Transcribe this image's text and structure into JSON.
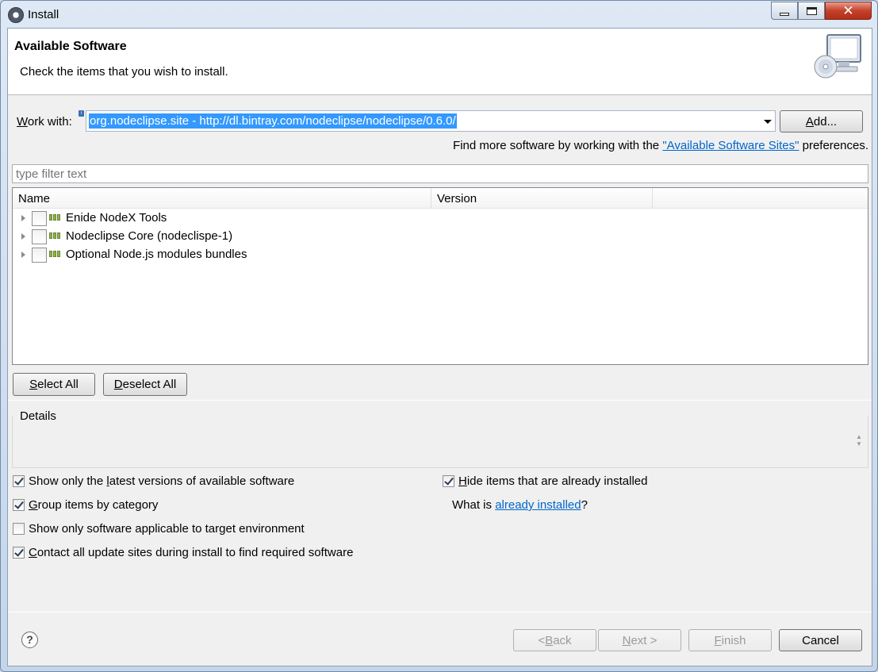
{
  "window": {
    "title": "Install"
  },
  "header": {
    "title": "Available Software",
    "description": "Check the items that you wish to install."
  },
  "work_with": {
    "label_underline": "W",
    "label_rest": "ork with:",
    "value": "org.nodeclipse.site - http://dl.bintray.com/nodeclipse/nodeclipse/0.6.0/",
    "add_label_underline": "A",
    "add_label_rest": "dd..."
  },
  "find_more": {
    "prefix": "Find more software by working with the ",
    "link": "\"Available Software Sites\"",
    "suffix": " preferences."
  },
  "filter": {
    "placeholder": "type filter text"
  },
  "tree": {
    "columns": [
      "Name",
      "Version"
    ],
    "items": [
      {
        "label": "Enide NodeX Tools"
      },
      {
        "label": "Nodeclipse Core (nodeclispe-1)"
      },
      {
        "label": "Optional Node.js modules bundles"
      }
    ]
  },
  "selection_buttons": {
    "select_all_u": "S",
    "select_all_rest": "elect All",
    "deselect_all_u": "D",
    "deselect_all_rest": "eselect All"
  },
  "details": {
    "label": "Details"
  },
  "options": {
    "latest": {
      "pre": "Show only the ",
      "u": "l",
      "post": "atest versions of available software"
    },
    "group": {
      "pre": "",
      "u": "G",
      "post": "roup items by category"
    },
    "applicable": {
      "pre": "Show only software applicable to target environment",
      "u": "",
      "post": ""
    },
    "contact": {
      "pre": "",
      "u": "C",
      "post": "ontact all update sites during install to find required software"
    },
    "hide": {
      "pre": "",
      "u": "H",
      "post": "ide items that are already installed"
    }
  },
  "what_is": {
    "prefix": "What is ",
    "link": "already installed",
    "suffix": "?"
  },
  "footer": {
    "help": "?",
    "back_pre": "< ",
    "back_u": "B",
    "back_post": "ack",
    "next_u": "N",
    "next_post": "ext >",
    "finish_u": "F",
    "finish_post": "inish",
    "cancel": "Cancel"
  }
}
